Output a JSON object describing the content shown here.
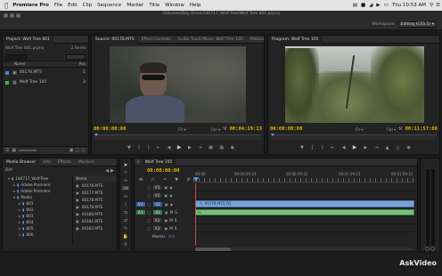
{
  "menubar": {
    "app_name": "Premiere Pro",
    "menus": [
      "File",
      "Edit",
      "Clip",
      "Sequence",
      "Marker",
      "Title",
      "Window",
      "Help"
    ],
    "clock": "Thu 10:53 AM"
  },
  "window": {
    "path": "/Volumes/Bay Drive/140717_Wolf-Tree/Wolf Tree 801.prproj",
    "workspace_label": "Workspace:",
    "workspace_value": "Editing (CS5.5)"
  },
  "project": {
    "tab": "Project: Wolf Tree 801",
    "file": "Wolf Tree 801.prproj",
    "count": "2 Items",
    "col_name": "Name",
    "col_pos": "Pos",
    "items": [
      {
        "name": "00178.MTS",
        "pos": "1",
        "color": "#4f7fd1"
      },
      {
        "name": "Wolf Tree 105",
        "pos": "2",
        "color": "#3bb84b"
      }
    ]
  },
  "source": {
    "tabs": [
      "Source: 00178.MTS",
      "Effect Controls",
      "Audio Track Mixer: Wolf Tree 105",
      "Metadata"
    ],
    "tc_left": "00:00:00:00",
    "fit": "Fit",
    "full": "Full",
    "tc_right": "00:04:19:13"
  },
  "program": {
    "tab": "Program: Wolf Tree 105",
    "tc_left": "00:00:00:00",
    "fit": "Fit",
    "full": "Full",
    "tc_right": "00:11:57:00"
  },
  "media_browser": {
    "tabs": [
      "Media Browser",
      "Info",
      "Effects",
      "Markers"
    ],
    "drive": "BAY",
    "tree": [
      {
        "label": "140717_Wolf-Tree",
        "depth": 1
      },
      {
        "label": "Adobe Premiere",
        "depth": 2
      },
      {
        "label": "Adobe Premiere",
        "depth": 2
      },
      {
        "label": "Media",
        "depth": 2
      },
      {
        "label": "B01",
        "depth": 3
      },
      {
        "label": "B02",
        "depth": 3
      },
      {
        "label": "B03",
        "depth": 3
      },
      {
        "label": "B04",
        "depth": 3
      },
      {
        "label": "B05",
        "depth": 3
      },
      {
        "label": "B06",
        "depth": 3
      }
    ],
    "file_col": "Name",
    "files": [
      "00176.MTS",
      "00177.MTS",
      "00178.MTS",
      "00179.MTS",
      "00180.MTS",
      "00181.MTS",
      "00182.MTS"
    ]
  },
  "timeline": {
    "tab": "Wolf Tree 105",
    "tc": "00:00:00:00",
    "ruler": [
      "00:00",
      "00:00:29:23",
      "00:00:59:22",
      "00:01:29:21",
      "00:01:59:21"
    ],
    "video_tracks": [
      "V3",
      "V2",
      "V1"
    ],
    "audio_tracks": [
      "A1",
      "A2",
      "A3"
    ],
    "master": "Master",
    "master_val": "0.0",
    "video_clip": "00178.MTS [V]",
    "progress": 0.27
  },
  "watermark": "AskVideo"
}
